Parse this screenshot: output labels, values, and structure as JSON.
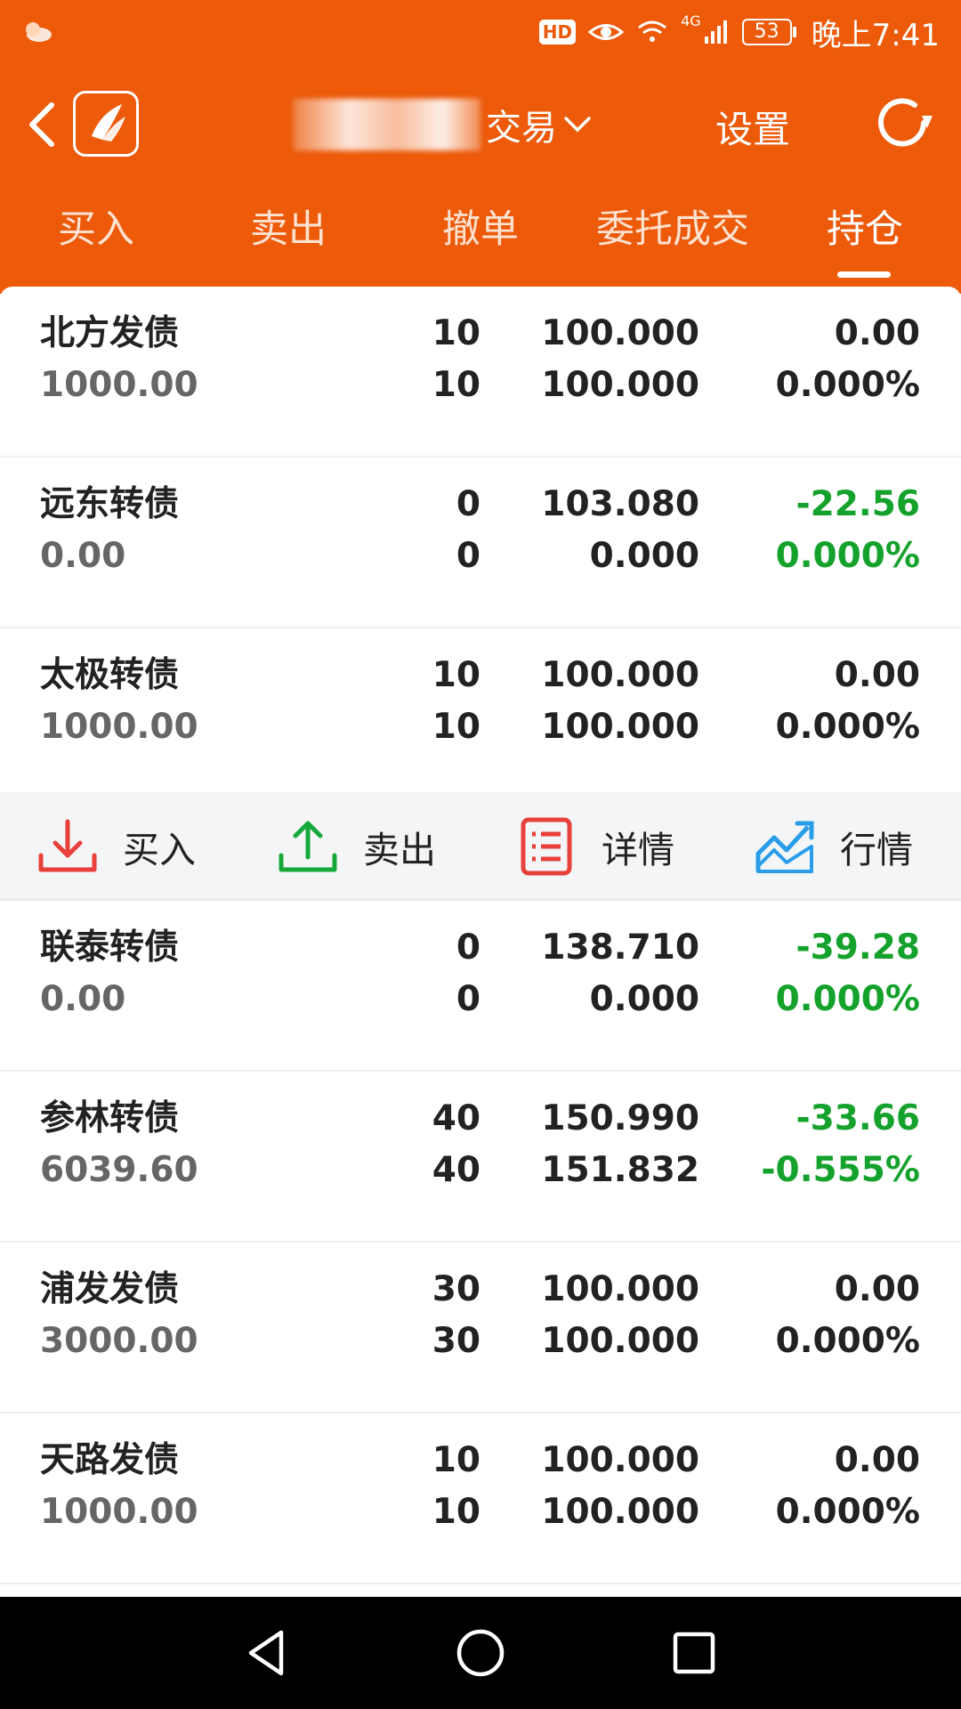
{
  "status": {
    "time": "晚上7:41",
    "battery": "53",
    "hd": "HD",
    "network": "4G"
  },
  "header": {
    "title": "交易",
    "settings_label": "设置"
  },
  "tabs": [
    {
      "label": "买入"
    },
    {
      "label": "卖出"
    },
    {
      "label": "撤单"
    },
    {
      "label": "委托成交"
    },
    {
      "label": "持仓"
    }
  ],
  "positions": [
    {
      "name": "北方发债",
      "value": "1000.00",
      "qty1": "10",
      "qty2": "10",
      "price1": "100.000",
      "price2": "100.000",
      "pl": "0.00",
      "pl_pct": "0.000%"
    },
    {
      "name": "远东转债",
      "value": "0.00",
      "qty1": "0",
      "qty2": "0",
      "price1": "103.080",
      "price2": "0.000",
      "pl": "-22.56",
      "pl_pct": "0.000%"
    },
    {
      "name": "太极转债",
      "value": "1000.00",
      "qty1": "10",
      "qty2": "10",
      "price1": "100.000",
      "price2": "100.000",
      "pl": "0.00",
      "pl_pct": "0.000%"
    },
    {
      "name": "联泰转债",
      "value": "0.00",
      "qty1": "0",
      "qty2": "0",
      "price1": "138.710",
      "price2": "0.000",
      "pl": "-39.28",
      "pl_pct": "0.000%"
    },
    {
      "name": "参林转债",
      "value": "6039.60",
      "qty1": "40",
      "qty2": "40",
      "price1": "150.990",
      "price2": "151.832",
      "pl": "-33.66",
      "pl_pct": "-0.555%"
    },
    {
      "name": "浦发发债",
      "value": "3000.00",
      "qty1": "30",
      "qty2": "30",
      "price1": "100.000",
      "price2": "100.000",
      "pl": "0.00",
      "pl_pct": "0.000%"
    },
    {
      "name": "天路发债",
      "value": "1000.00",
      "qty1": "10",
      "qty2": "10",
      "price1": "100.000",
      "price2": "100.000",
      "pl": "0.00",
      "pl_pct": "0.000%"
    }
  ],
  "actions": [
    {
      "label": "买入",
      "icon": "download-icon",
      "color": "#e8403a"
    },
    {
      "label": "卖出",
      "icon": "upload-icon",
      "color": "#17a83a"
    },
    {
      "label": "详情",
      "icon": "list-icon",
      "color": "#e8403a"
    },
    {
      "label": "行情",
      "icon": "chart-icon",
      "color": "#2a9de8"
    }
  ],
  "colors": {
    "brand": "#ec5a0a",
    "loss": "#15a22c",
    "text": "#222222",
    "subtext": "#666666"
  }
}
